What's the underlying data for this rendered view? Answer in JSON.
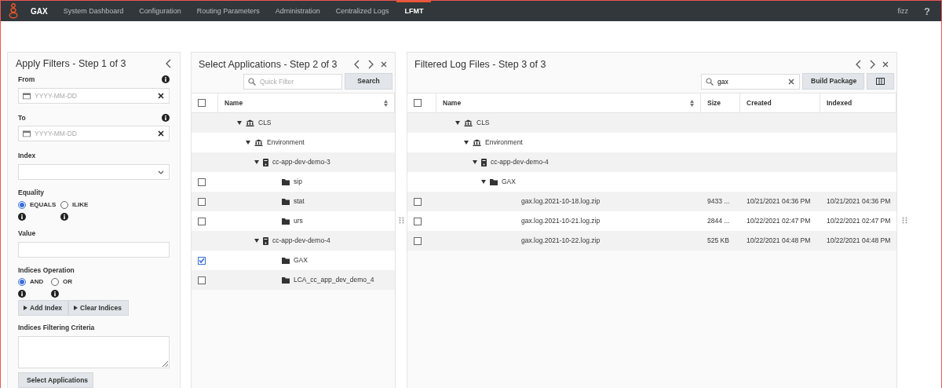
{
  "nav": {
    "brand": "GAX",
    "items": [
      {
        "label": "System Dashboard",
        "selected": false
      },
      {
        "label": "Configuration",
        "selected": false
      },
      {
        "label": "Routing Parameters",
        "selected": false
      },
      {
        "label": "Administration",
        "selected": false
      },
      {
        "label": "Centralized Logs",
        "selected": false
      },
      {
        "label": "LFMT",
        "selected": true
      }
    ],
    "user": "fizz",
    "help": "?"
  },
  "filters": {
    "title": "Apply Filters - Step 1 of 3",
    "from": {
      "label": "From",
      "placeholder": "YYYY-MM-DD"
    },
    "to": {
      "label": "To",
      "placeholder": "YYYY-MM-DD"
    },
    "index": {
      "label": "Index"
    },
    "equality": {
      "label": "Equality",
      "options": [
        {
          "label": "EQUALS",
          "selected": true
        },
        {
          "label": "ILIKE",
          "selected": false
        }
      ]
    },
    "value": {
      "label": "Value"
    },
    "indices_operation": {
      "label": "Indices Operation",
      "options": [
        {
          "label": "AND",
          "selected": true
        },
        {
          "label": "OR",
          "selected": false
        }
      ]
    },
    "buttons": [
      "Add Index",
      "Clear Indices"
    ],
    "criteria": {
      "label": "Indices Filtering Criteria"
    },
    "submit": "Select Applications"
  },
  "apps": {
    "title": "Select Applications - Step 2 of 3",
    "filter": {
      "placeholder": "Quick Filter"
    },
    "search_button": "Search",
    "all_checked": false,
    "columns": [
      "Name"
    ],
    "tree": [
      {
        "label": "CLS",
        "kind": "site",
        "expanded": true,
        "children": [
          {
            "label": "Environment",
            "kind": "site",
            "expanded": true,
            "children": [
              {
                "label": "cc-app-dev-demo-3",
                "kind": "host",
                "expanded": true,
                "children": [
                  {
                    "label": "sip",
                    "kind": "folder",
                    "checked": false
                  },
                  {
                    "label": "stat",
                    "kind": "folder",
                    "checked": false
                  },
                  {
                    "label": "urs",
                    "kind": "folder",
                    "checked": false
                  }
                ]
              },
              {
                "label": "cc-app-dev-demo-4",
                "kind": "host",
                "expanded": true,
                "children": [
                  {
                    "label": "GAX",
                    "kind": "folder",
                    "checked": true
                  },
                  {
                    "label": "LCA_cc_app_dev_demo_4",
                    "kind": "folder",
                    "checked": false
                  }
                ]
              }
            ]
          }
        ]
      }
    ]
  },
  "logs": {
    "title": "Filtered Log Files - Step 3 of 3",
    "search": {
      "value": "gax"
    },
    "build_button": "Build Package",
    "all_checked": false,
    "columns": [
      "Name",
      "Size",
      "Created",
      "Indexed"
    ],
    "tree": [
      {
        "label": "CLS",
        "kind": "site",
        "expanded": true,
        "children": [
          {
            "label": "Environment",
            "kind": "site",
            "expanded": true,
            "children": [
              {
                "label": "cc-app-dev-demo-4",
                "kind": "host",
                "expanded": true,
                "children": [
                  {
                    "label": "GAX",
                    "kind": "folder",
                    "expanded": true,
                    "children": [
                      {
                        "label": "gax.log.2021-10-18.log.zip",
                        "checked": false,
                        "size": "9433 ...",
                        "created": "10/21/2021 04:36 PM",
                        "indexed": "10/21/2021 04:36 PM"
                      },
                      {
                        "label": "gax.log.2021-10-21.log.zip",
                        "checked": false,
                        "size": "2844 ...",
                        "created": "10/22/2021 02:47 PM",
                        "indexed": "10/22/2021 02:47 PM"
                      },
                      {
                        "label": "gax.log.2021-10-22.log.zip",
                        "checked": false,
                        "size": "525 KB",
                        "created": "10/22/2021 04:48 PM",
                        "indexed": "10/22/2021 04:48 PM"
                      }
                    ]
                  }
                ]
              }
            ]
          }
        ]
      }
    ]
  }
}
